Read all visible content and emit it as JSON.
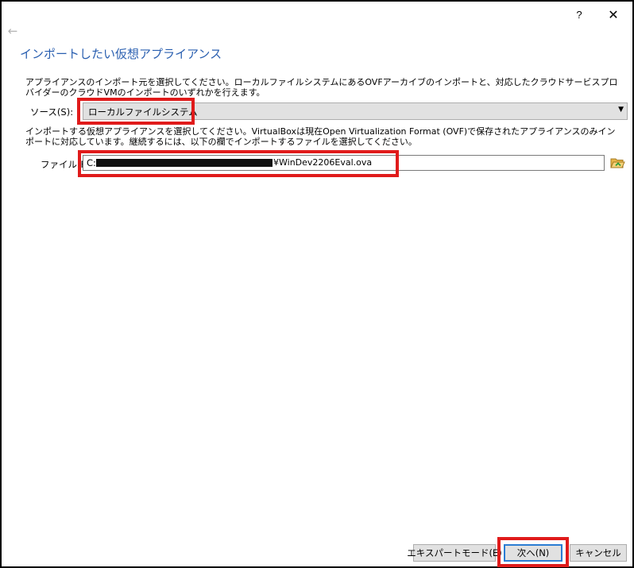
{
  "titlebar": {
    "help_icon": "help-icon",
    "help_glyph": "?",
    "close_icon": "close-icon",
    "close_glyph": "✕"
  },
  "nav": {
    "back_icon": "back-arrow-icon",
    "back_glyph": "←"
  },
  "heading": "インポートしたい仮想アプライアンス",
  "source_description": "アプライアンスのインポート元を選択してください。ローカルファイルシステムにあるOVFアーカイブのインポートと、対応したクラウドサービスプロバイダーのクラウドVMのインポートのいずれかを行えます。",
  "source": {
    "label": "ソース(S):",
    "selected_value": "ローカルファイルシステム",
    "dropdown_icon": "chevron-down-icon",
    "dropdown_glyph": "▼"
  },
  "file_description": "インポートする仮想アプライアンスを選択してください。VirtualBoxは現在Open Virtualization Format (OVF)で保存されたアプライアンスのみインポートに対応しています。継続するには、以下の欄でインポートするファイルを選択してください。",
  "file": {
    "label": "ファイル(F):",
    "value_prefix": "C:",
    "value_suffix": "¥WinDev2206Eval.ova",
    "browse_icon": "folder-open-icon"
  },
  "buttons": {
    "expert_mode": "エキスパートモード(E)",
    "next": "次へ(N)",
    "cancel": "キャンセル"
  },
  "colors": {
    "heading": "#2a5fb0",
    "callout": "#e01b1b",
    "default_button_border": "#2b7cd3"
  }
}
